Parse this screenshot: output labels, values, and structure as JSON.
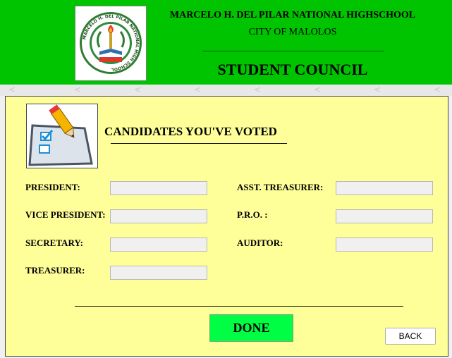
{
  "header": {
    "school_name": "MARCELO H. DEL PILAR NATIONAL HIGHSCHOOL",
    "city": "CITY OF MALOLOS",
    "title": "STUDENT COUNCIL",
    "seal": {
      "icon": "school-seal-icon",
      "ring_text": "MARCELO H. DEL PILAR NATIONAL HIGH SCHOOL",
      "bottom_text": "CITY OF MALOLOS"
    },
    "bg_color": "#00c400"
  },
  "panel": {
    "icon": "ballot-checklist-icon",
    "title": "CANDIDATES YOU'VE VOTED",
    "bg_color": "#ffff99"
  },
  "fields": {
    "president": {
      "label": "PRESIDENT:",
      "value": ""
    },
    "vice_president": {
      "label": "VICE PRESIDENT:",
      "value": ""
    },
    "secretary": {
      "label": "SECRETARY:",
      "value": ""
    },
    "treasurer": {
      "label": "TREASURER:",
      "value": ""
    },
    "asst_treasurer": {
      "label": "ASST. TREASURER:",
      "value": ""
    },
    "pro": {
      "label": "P.R.O. :",
      "value": ""
    },
    "auditor": {
      "label": "AUDITOR:",
      "value": ""
    }
  },
  "buttons": {
    "done": "DONE",
    "back": "BACK",
    "done_color": "#00ff44"
  }
}
